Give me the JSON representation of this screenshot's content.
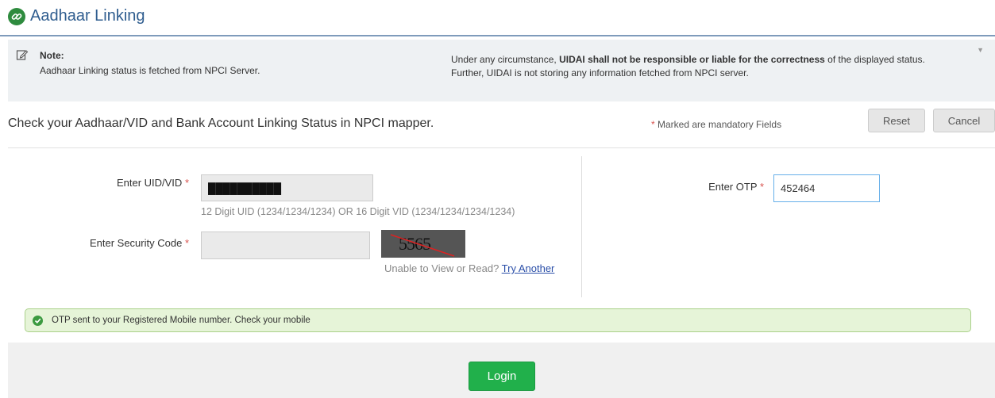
{
  "header": {
    "title": "Aadhaar Linking",
    "icon": "link-icon",
    "accent_color": "#2f5d8f"
  },
  "note": {
    "title": "Note:",
    "left_text": "Aadhaar Linking status is fetched from NPCI Server.",
    "right_prefix": "Under any circumstance, ",
    "right_bold": "UIDAI shall not be responsible or liable for the correctness",
    "right_suffix": " of the displayed status. Further, UIDAI is not storing any information fetched from NPCI server."
  },
  "heading": "Check your Aadhaar/VID and Bank Account Linking Status in NPCI mapper.",
  "mandatory": {
    "star": "*",
    "text": " Marked are mandatory Fields"
  },
  "buttons": {
    "reset": "Reset",
    "cancel": "Cancel",
    "login": "Login"
  },
  "form": {
    "uid_label": "Enter UID/VID",
    "uid_value": "██████████",
    "uid_hint": "12 Digit UID (1234/1234/1234) OR 16 Digit VID (1234/1234/1234/1234)",
    "security_label": "Enter Security Code",
    "security_value": "",
    "captcha_text": "5565",
    "unable_text": "Unable to View or Read? ",
    "try_another": "Try Another",
    "otp_label": "Enter OTP",
    "otp_value": "452464",
    "required_star": "*"
  },
  "alert": {
    "text": "OTP sent to your Registered Mobile number. Check your mobile",
    "color": "#3c9a40"
  },
  "colors": {
    "login_button": "#21b04b",
    "required_star": "#d9534f"
  }
}
